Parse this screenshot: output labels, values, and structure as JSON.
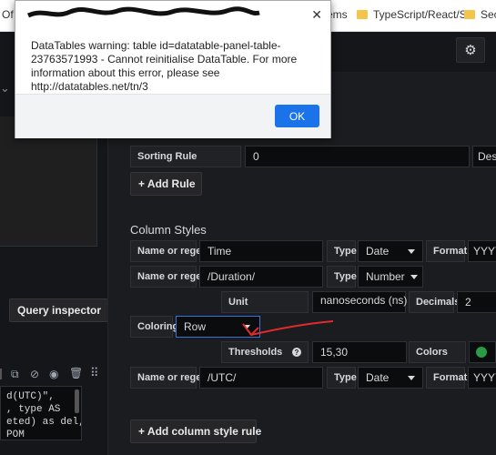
{
  "browser": {
    "bookmark_partial": "Of",
    "bookmarks": [
      {
        "label": "ems"
      },
      {
        "label": "TypeScript/React/S..."
      },
      {
        "label": "Secu"
      }
    ]
  },
  "dialog": {
    "message": "DataTables warning: table id=datatable-panel-table-23763571993 - Cannot reinitialise DataTable. For more information about this error, please see http://datatables.net/tn/3",
    "ok_label": "OK"
  },
  "left": {
    "query_inspector_label": "Query inspector",
    "query_text": "d(UTC)\",\n, type AS\neted) as del,\nPOM"
  },
  "sorting": {
    "label": "Sorting Rule",
    "value": "0",
    "order": "Des",
    "add_rule_label": "+ Add Rule"
  },
  "column_styles": {
    "title": "Column Styles",
    "rows": [
      {
        "name_label": "Name or regex",
        "name_value": "Time",
        "type_label": "Type",
        "type_value": "Date",
        "format_label": "Format",
        "format_value": "YYYY-"
      },
      {
        "name_label": "Name or regex",
        "name_value": "/Duration/",
        "type_label": "Type",
        "type_value": "Number"
      },
      {
        "name_label": "Name or regex",
        "name_value": "/UTC/",
        "type_label": "Type",
        "type_value": "Date",
        "format_label": "Format",
        "format_value": "YYYY-"
      }
    ],
    "unit": {
      "label": "Unit",
      "value": "nanoseconds (ns)",
      "decimals_label": "Decimals",
      "decimals_value": "2"
    },
    "coloring": {
      "label": "Coloring",
      "value": "Row"
    },
    "thresholds": {
      "label": "Thresholds",
      "help": "?",
      "value": "15,30",
      "colors_label": "Colors"
    },
    "add_label": "+ Add column style rule"
  },
  "colors": {
    "accent_green": "#299c46",
    "annotation_red": "#e02b2b",
    "ok_blue": "#1a73e8"
  }
}
